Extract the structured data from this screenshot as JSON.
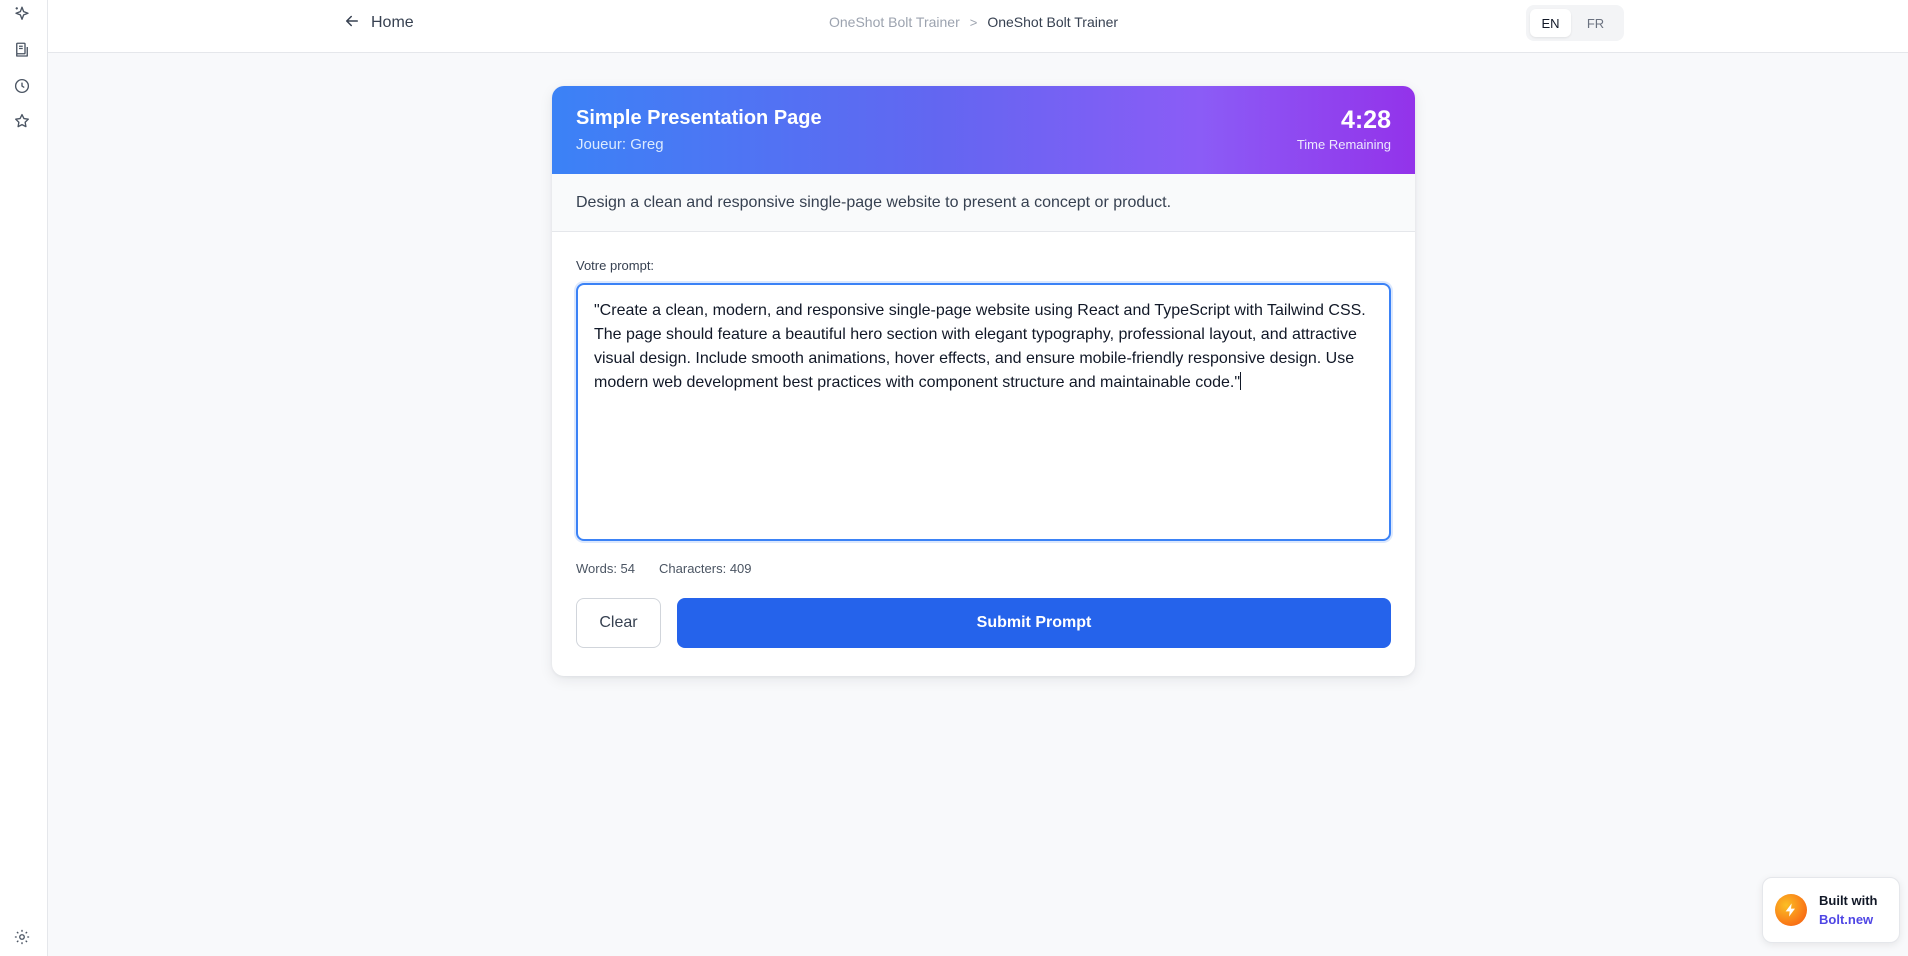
{
  "topbar": {
    "home_label": "Home",
    "breadcrumb": [
      "OneShot Bolt Trainer",
      "OneShot Bolt Trainer"
    ],
    "breadcrumb_separator": ">",
    "languages": [
      "EN",
      "FR"
    ],
    "active_language": "EN"
  },
  "sidebar": {
    "icons": [
      "sparkle-icon",
      "library-icon",
      "clock-icon",
      "star-icon",
      "gear-icon"
    ]
  },
  "card": {
    "title": "Simple Presentation Page",
    "player": "Joueur: Greg",
    "timer": "4:28",
    "timer_label": "Time Remaining",
    "description": "Design a clean and responsive single-page website to present a concept or product.",
    "prompt_label": "Votre prompt:",
    "prompt_value": "\"Create a clean, modern, and responsive single-page website using React and TypeScript with Tailwind CSS. The page should feature a beautiful hero section with elegant typography, professional layout, and attractive visual design. Include smooth animations, hover effects, and ensure mobile-friendly responsive design. Use modern web development best practices with component structure and maintainable code.\"",
    "words": "Words: 54",
    "characters": "Characters: 409",
    "clear_label": "Clear",
    "submit_label": "Submit Prompt"
  },
  "badge": {
    "line1": "Built with",
    "line2": "Bolt.new"
  },
  "colors": {
    "accent": "#2563eb",
    "header_gradient_start": "#3b82f6",
    "header_gradient_end": "#9333ea",
    "brand_link": "#4f46e5"
  }
}
